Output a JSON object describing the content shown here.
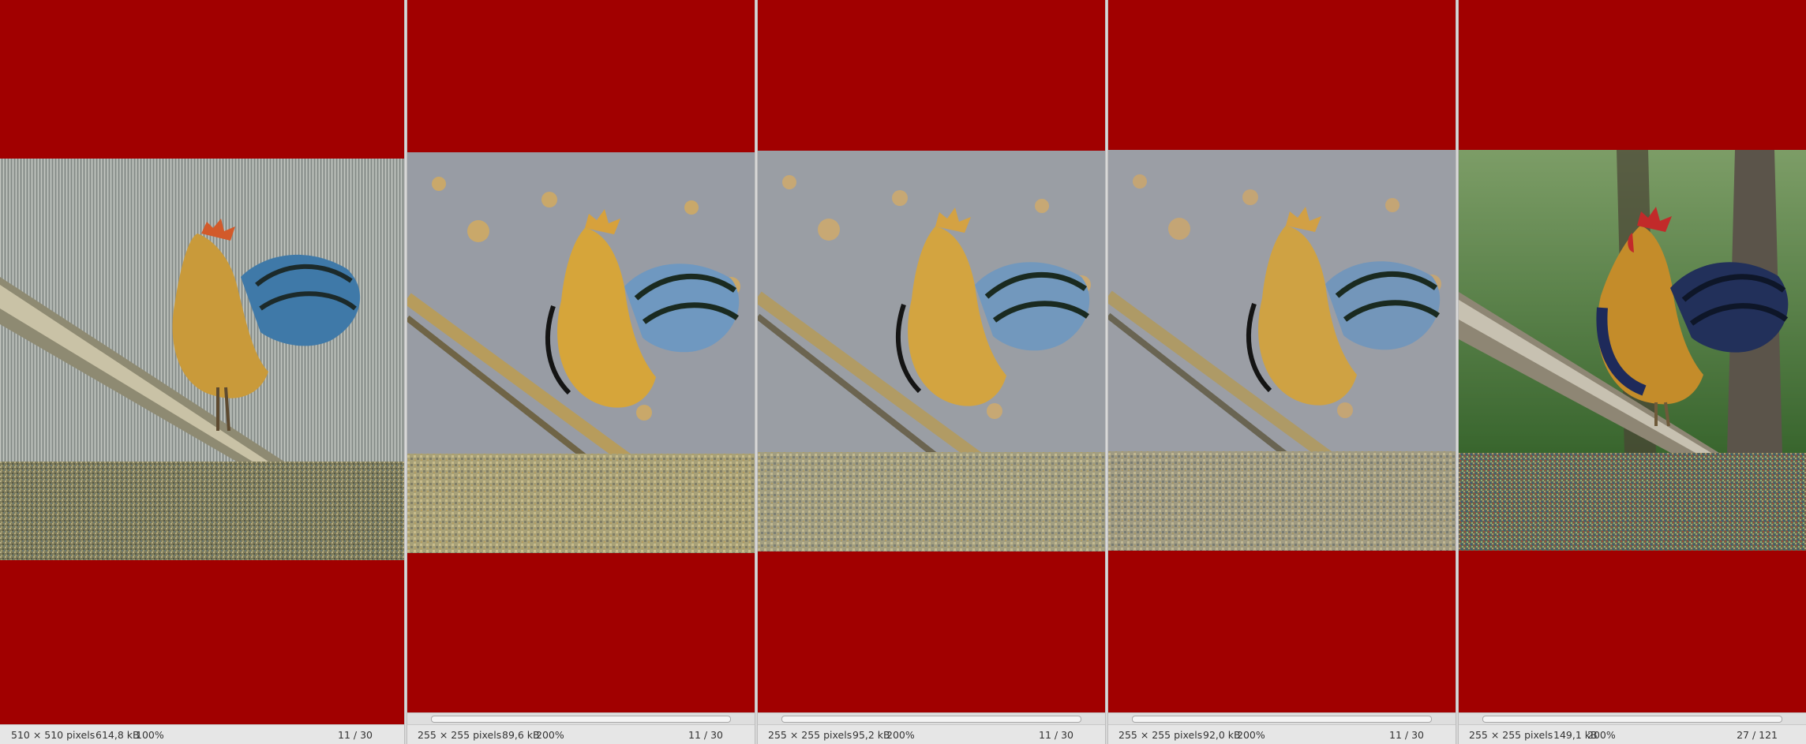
{
  "viewers": [
    {
      "dims": "510 × 510 pixels",
      "size": "614,8 kB",
      "zoom": "100%",
      "counter": "11 / 30"
    },
    {
      "dims": "255 × 255 pixels",
      "size": "89,6 kB",
      "zoom": "200%",
      "counter": "11 / 30"
    },
    {
      "dims": "255 × 255 pixels",
      "size": "95,2 kB",
      "zoom": "200%",
      "counter": "11 / 30"
    },
    {
      "dims": "255 × 255 pixels",
      "size": "92,0 kB",
      "zoom": "200%",
      "counter": "11 / 30"
    },
    {
      "dims": "255 × 255 pixels",
      "size": "149,1 kB",
      "zoom": "200%",
      "counter": "27 / 121"
    }
  ],
  "colors": {
    "canvas_background": "#a10000",
    "statusbar_background": "#e6e6e6"
  },
  "icons": [
    "rooster-image"
  ]
}
